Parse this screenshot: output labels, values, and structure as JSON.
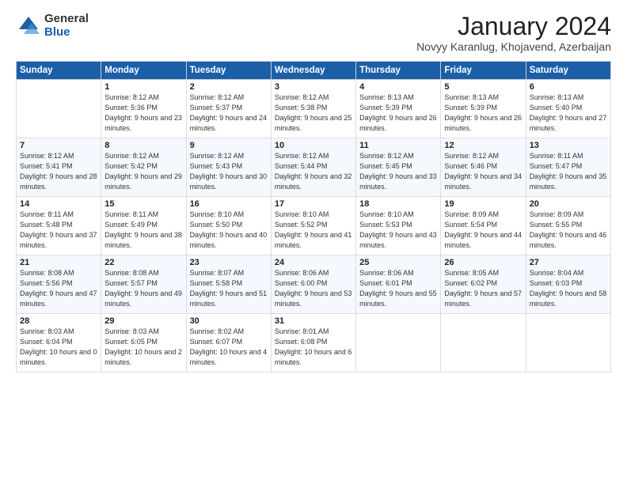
{
  "logo": {
    "general": "General",
    "blue": "Blue"
  },
  "header": {
    "month": "January 2024",
    "location": "Novyy Karanlug, Khojavend, Azerbaijan"
  },
  "columns": [
    "Sunday",
    "Monday",
    "Tuesday",
    "Wednesday",
    "Thursday",
    "Friday",
    "Saturday"
  ],
  "weeks": [
    [
      {
        "day": "",
        "sunrise": "",
        "sunset": "",
        "daylight": ""
      },
      {
        "day": "1",
        "sunrise": "Sunrise: 8:12 AM",
        "sunset": "Sunset: 5:36 PM",
        "daylight": "Daylight: 9 hours and 23 minutes."
      },
      {
        "day": "2",
        "sunrise": "Sunrise: 8:12 AM",
        "sunset": "Sunset: 5:37 PM",
        "daylight": "Daylight: 9 hours and 24 minutes."
      },
      {
        "day": "3",
        "sunrise": "Sunrise: 8:12 AM",
        "sunset": "Sunset: 5:38 PM",
        "daylight": "Daylight: 9 hours and 25 minutes."
      },
      {
        "day": "4",
        "sunrise": "Sunrise: 8:13 AM",
        "sunset": "Sunset: 5:39 PM",
        "daylight": "Daylight: 9 hours and 26 minutes."
      },
      {
        "day": "5",
        "sunrise": "Sunrise: 8:13 AM",
        "sunset": "Sunset: 5:39 PM",
        "daylight": "Daylight: 9 hours and 26 minutes."
      },
      {
        "day": "6",
        "sunrise": "Sunrise: 8:13 AM",
        "sunset": "Sunset: 5:40 PM",
        "daylight": "Daylight: 9 hours and 27 minutes."
      }
    ],
    [
      {
        "day": "7",
        "sunrise": "Sunrise: 8:12 AM",
        "sunset": "Sunset: 5:41 PM",
        "daylight": "Daylight: 9 hours and 28 minutes."
      },
      {
        "day": "8",
        "sunrise": "Sunrise: 8:12 AM",
        "sunset": "Sunset: 5:42 PM",
        "daylight": "Daylight: 9 hours and 29 minutes."
      },
      {
        "day": "9",
        "sunrise": "Sunrise: 8:12 AM",
        "sunset": "Sunset: 5:43 PM",
        "daylight": "Daylight: 9 hours and 30 minutes."
      },
      {
        "day": "10",
        "sunrise": "Sunrise: 8:12 AM",
        "sunset": "Sunset: 5:44 PM",
        "daylight": "Daylight: 9 hours and 32 minutes."
      },
      {
        "day": "11",
        "sunrise": "Sunrise: 8:12 AM",
        "sunset": "Sunset: 5:45 PM",
        "daylight": "Daylight: 9 hours and 33 minutes."
      },
      {
        "day": "12",
        "sunrise": "Sunrise: 8:12 AM",
        "sunset": "Sunset: 5:46 PM",
        "daylight": "Daylight: 9 hours and 34 minutes."
      },
      {
        "day": "13",
        "sunrise": "Sunrise: 8:11 AM",
        "sunset": "Sunset: 5:47 PM",
        "daylight": "Daylight: 9 hours and 35 minutes."
      }
    ],
    [
      {
        "day": "14",
        "sunrise": "Sunrise: 8:11 AM",
        "sunset": "Sunset: 5:48 PM",
        "daylight": "Daylight: 9 hours and 37 minutes."
      },
      {
        "day": "15",
        "sunrise": "Sunrise: 8:11 AM",
        "sunset": "Sunset: 5:49 PM",
        "daylight": "Daylight: 9 hours and 38 minutes."
      },
      {
        "day": "16",
        "sunrise": "Sunrise: 8:10 AM",
        "sunset": "Sunset: 5:50 PM",
        "daylight": "Daylight: 9 hours and 40 minutes."
      },
      {
        "day": "17",
        "sunrise": "Sunrise: 8:10 AM",
        "sunset": "Sunset: 5:52 PM",
        "daylight": "Daylight: 9 hours and 41 minutes."
      },
      {
        "day": "18",
        "sunrise": "Sunrise: 8:10 AM",
        "sunset": "Sunset: 5:53 PM",
        "daylight": "Daylight: 9 hours and 43 minutes."
      },
      {
        "day": "19",
        "sunrise": "Sunrise: 8:09 AM",
        "sunset": "Sunset: 5:54 PM",
        "daylight": "Daylight: 9 hours and 44 minutes."
      },
      {
        "day": "20",
        "sunrise": "Sunrise: 8:09 AM",
        "sunset": "Sunset: 5:55 PM",
        "daylight": "Daylight: 9 hours and 46 minutes."
      }
    ],
    [
      {
        "day": "21",
        "sunrise": "Sunrise: 8:08 AM",
        "sunset": "Sunset: 5:56 PM",
        "daylight": "Daylight: 9 hours and 47 minutes."
      },
      {
        "day": "22",
        "sunrise": "Sunrise: 8:08 AM",
        "sunset": "Sunset: 5:57 PM",
        "daylight": "Daylight: 9 hours and 49 minutes."
      },
      {
        "day": "23",
        "sunrise": "Sunrise: 8:07 AM",
        "sunset": "Sunset: 5:58 PM",
        "daylight": "Daylight: 9 hours and 51 minutes."
      },
      {
        "day": "24",
        "sunrise": "Sunrise: 8:06 AM",
        "sunset": "Sunset: 6:00 PM",
        "daylight": "Daylight: 9 hours and 53 minutes."
      },
      {
        "day": "25",
        "sunrise": "Sunrise: 8:06 AM",
        "sunset": "Sunset: 6:01 PM",
        "daylight": "Daylight: 9 hours and 55 minutes."
      },
      {
        "day": "26",
        "sunrise": "Sunrise: 8:05 AM",
        "sunset": "Sunset: 6:02 PM",
        "daylight": "Daylight: 9 hours and 57 minutes."
      },
      {
        "day": "27",
        "sunrise": "Sunrise: 8:04 AM",
        "sunset": "Sunset: 6:03 PM",
        "daylight": "Daylight: 9 hours and 58 minutes."
      }
    ],
    [
      {
        "day": "28",
        "sunrise": "Sunrise: 8:03 AM",
        "sunset": "Sunset: 6:04 PM",
        "daylight": "Daylight: 10 hours and 0 minutes."
      },
      {
        "day": "29",
        "sunrise": "Sunrise: 8:03 AM",
        "sunset": "Sunset: 6:05 PM",
        "daylight": "Daylight: 10 hours and 2 minutes."
      },
      {
        "day": "30",
        "sunrise": "Sunrise: 8:02 AM",
        "sunset": "Sunset: 6:07 PM",
        "daylight": "Daylight: 10 hours and 4 minutes."
      },
      {
        "day": "31",
        "sunrise": "Sunrise: 8:01 AM",
        "sunset": "Sunset: 6:08 PM",
        "daylight": "Daylight: 10 hours and 6 minutes."
      },
      {
        "day": "",
        "sunrise": "",
        "sunset": "",
        "daylight": ""
      },
      {
        "day": "",
        "sunrise": "",
        "sunset": "",
        "daylight": ""
      },
      {
        "day": "",
        "sunrise": "",
        "sunset": "",
        "daylight": ""
      }
    ]
  ]
}
